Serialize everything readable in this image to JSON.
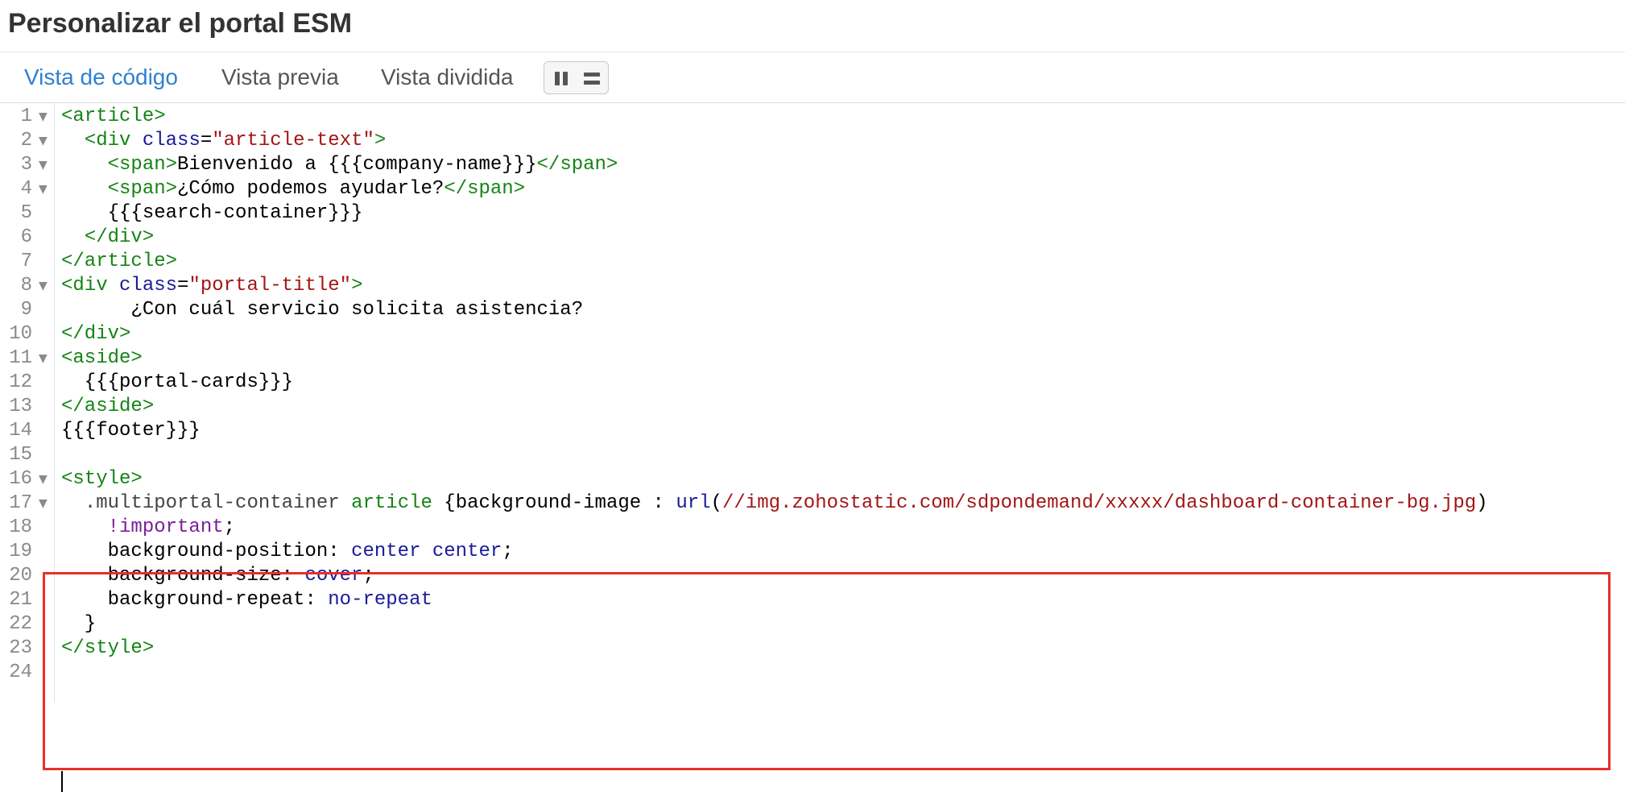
{
  "page": {
    "title": "Personalizar el portal ESM"
  },
  "tabs": [
    {
      "label": "Vista de código",
      "active": true
    },
    {
      "label": "Vista previa",
      "active": false
    },
    {
      "label": "Vista dividida",
      "active": false
    }
  ],
  "toggle": {
    "icons": [
      "pause-icon",
      "equals-icon"
    ]
  },
  "editor": {
    "lines": [
      {
        "num": "1",
        "fold": true
      },
      {
        "num": "2",
        "fold": true
      },
      {
        "num": "3",
        "fold": true
      },
      {
        "num": "4",
        "fold": true
      },
      {
        "num": "5",
        "fold": false
      },
      {
        "num": "6",
        "fold": false
      },
      {
        "num": "7",
        "fold": false
      },
      {
        "num": "8",
        "fold": true
      },
      {
        "num": "9",
        "fold": false
      },
      {
        "num": "10",
        "fold": false
      },
      {
        "num": "11",
        "fold": true
      },
      {
        "num": "12",
        "fold": false
      },
      {
        "num": "13",
        "fold": false
      },
      {
        "num": "14",
        "fold": false
      },
      {
        "num": "15",
        "fold": false
      },
      {
        "num": "16",
        "fold": true
      },
      {
        "num": "17",
        "fold": true
      },
      {
        "num": "18",
        "fold": false
      },
      {
        "num": "19",
        "fold": false
      },
      {
        "num": "20",
        "fold": false
      },
      {
        "num": "21",
        "fold": false
      },
      {
        "num": "22",
        "fold": false
      },
      {
        "num": "23",
        "fold": false
      },
      {
        "num": "24",
        "fold": false
      }
    ],
    "code": [
      [
        {
          "t": "<article>",
          "c": "tg"
        }
      ],
      [
        {
          "t": "  "
        },
        {
          "t": "<div ",
          "c": "tg"
        },
        {
          "t": "class",
          "c": "at"
        },
        {
          "t": "="
        },
        {
          "t": "\"article-text\"",
          "c": "st"
        },
        {
          "t": ">",
          "c": "tg"
        }
      ],
      [
        {
          "t": "    "
        },
        {
          "t": "<span>",
          "c": "tg"
        },
        {
          "t": "Bienvenido a {{{company-name}}}"
        },
        {
          "t": "</span>",
          "c": "tg"
        }
      ],
      [
        {
          "t": "    "
        },
        {
          "t": "<span>",
          "c": "tg"
        },
        {
          "t": "¿Cómo podemos ayudarle?"
        },
        {
          "t": "</span>",
          "c": "tg"
        }
      ],
      [
        {
          "t": "    {{{search-container}}}"
        }
      ],
      [
        {
          "t": "  "
        },
        {
          "t": "</div>",
          "c": "tg"
        }
      ],
      [
        {
          "t": "</article>",
          "c": "tg"
        }
      ],
      [
        {
          "t": "<div ",
          "c": "tg"
        },
        {
          "t": "class",
          "c": "at"
        },
        {
          "t": "="
        },
        {
          "t": "\"portal-title\"",
          "c": "st"
        },
        {
          "t": ">",
          "c": "tg"
        }
      ],
      [
        {
          "t": "      ¿Con cuál servicio solicita asistencia?"
        }
      ],
      [
        {
          "t": "</div>",
          "c": "tg"
        }
      ],
      [
        {
          "t": "<aside>",
          "c": "tg"
        }
      ],
      [
        {
          "t": "  {{{portal-cards}}}"
        }
      ],
      [
        {
          "t": "</aside>",
          "c": "tg"
        }
      ],
      [
        {
          "t": "{{{footer}}}"
        }
      ],
      [],
      [
        {
          "t": "<style>",
          "c": "tg"
        }
      ],
      [
        {
          "t": "  "
        },
        {
          "t": ".multiportal-container",
          "c": "sl"
        },
        {
          "t": " "
        },
        {
          "t": "article",
          "c": "tg"
        },
        {
          "t": " {background-image : "
        },
        {
          "t": "url",
          "c": "vl"
        },
        {
          "t": "("
        },
        {
          "t": "//img.zohostatic.com/sdpondemand/xxxxx/dashboard-container-bg.jpg",
          "c": "st"
        },
        {
          "t": ")"
        }
      ],
      [
        {
          "t": "    "
        },
        {
          "t": "!important",
          "c": "kw"
        },
        {
          "t": ";"
        }
      ],
      [
        {
          "t": "    background-position: "
        },
        {
          "t": "center center",
          "c": "vl"
        },
        {
          "t": ";"
        }
      ],
      [
        {
          "t": "    background-size: "
        },
        {
          "t": "cover",
          "c": "vl"
        },
        {
          "t": ";"
        }
      ],
      [
        {
          "t": "    background-repeat: "
        },
        {
          "t": "no-repeat",
          "c": "vl"
        }
      ],
      [
        {
          "t": "  }"
        }
      ],
      [
        {
          "t": "</style>",
          "c": "tg"
        }
      ],
      []
    ]
  }
}
